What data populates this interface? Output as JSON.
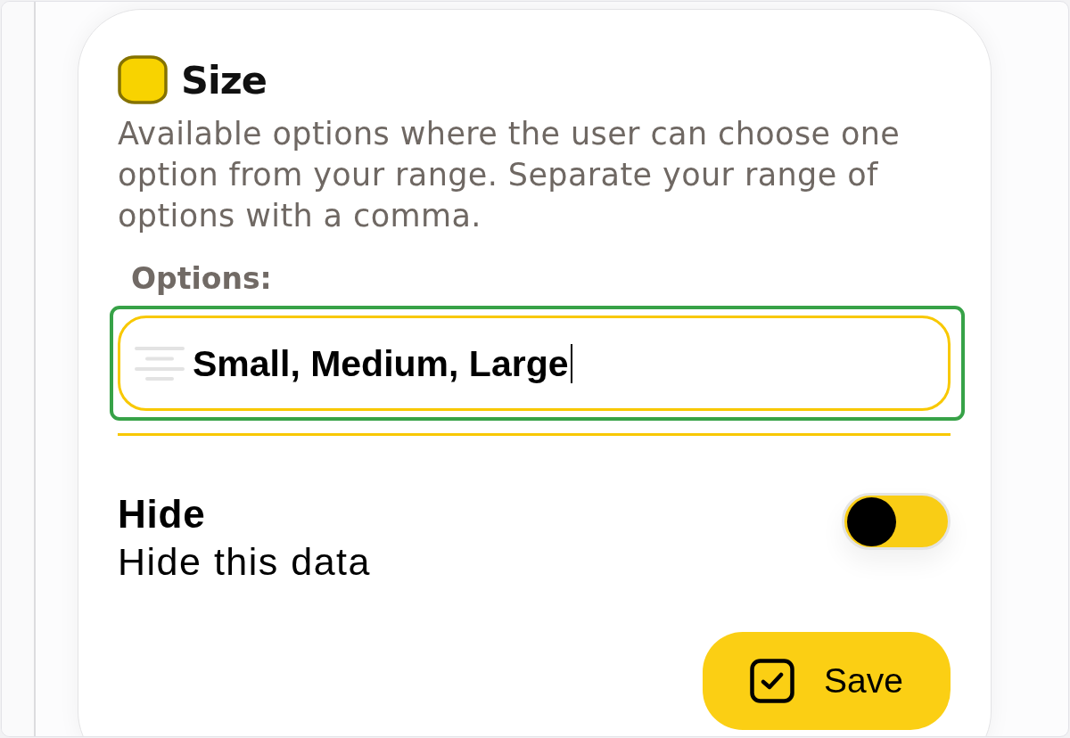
{
  "field": {
    "title": "Size",
    "description": "Available options where the user can choose one option from your range. Separate your range of options with a comma.",
    "options_label": "Options:",
    "options_input": {
      "value": "Small, Medium, Large",
      "focused": true
    },
    "hide_toggle": {
      "label": "Hide",
      "description": "Hide this data",
      "on": false
    }
  },
  "save_button": {
    "label": "Save"
  }
}
